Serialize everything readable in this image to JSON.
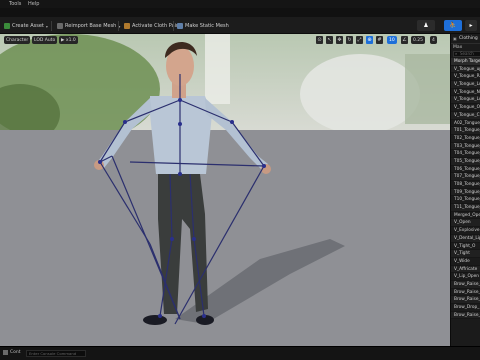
{
  "menu": {
    "items": [
      "Tools",
      "Help"
    ]
  },
  "toolbar": {
    "create_asset": "Create Asset",
    "reimport_base_mesh": "Reimport Base Mesh",
    "activate_cloth_paint": "Activate Cloth Paint",
    "make_static_mesh": "Make Static Mesh"
  },
  "viewport": {
    "view_mode": "Character",
    "lod": "LOD Auto",
    "play_rate": "x1.0",
    "fov": "0.25",
    "screen_pct": "4"
  },
  "right_panel": {
    "tab": "Clothing",
    "heading": "Max",
    "search_placeholder": "Search",
    "rows": [
      "Morph Target",
      "V_Tongue_up",
      "V_Tongue_Ra",
      "V_Tongue_Lo",
      "V_Tongue_Ne",
      "V_Tongue_Lo",
      "V_Tongue_Ou",
      "V_Tongue_Cu",
      "A02_Tongue_",
      "T01_Tongue_",
      "T02_Tongue_",
      "T03_Tongue_",
      "T04_Tongue_",
      "T05_Tongue_",
      "T06_Tongue_",
      "T07_Tongue_",
      "T08_Tongue_",
      "T09_Tongue_",
      "T10_Tongue_",
      "T11_Tongue_",
      "Merged_Open",
      "V_Open",
      "V_Explosive",
      "V_Dental_Lip",
      "V_Tight_O",
      "V_Tight",
      "V_Wide",
      "V_Affricate",
      "V_Lip_Open",
      "Brow_Raise_",
      "Brow_Raise_",
      "Brow_Raise_",
      "Brow_Drop_",
      "Brow_Raise_"
    ]
  },
  "status": {
    "drawer": "Cont",
    "cmd_placeholder": "Enter Console Command"
  },
  "colors": {
    "accent_blue": "#1e6fd9",
    "toolbar_bg": "#1c1c1c",
    "panel_bg": "#1b1b1b",
    "floor": "#8e8f93"
  }
}
